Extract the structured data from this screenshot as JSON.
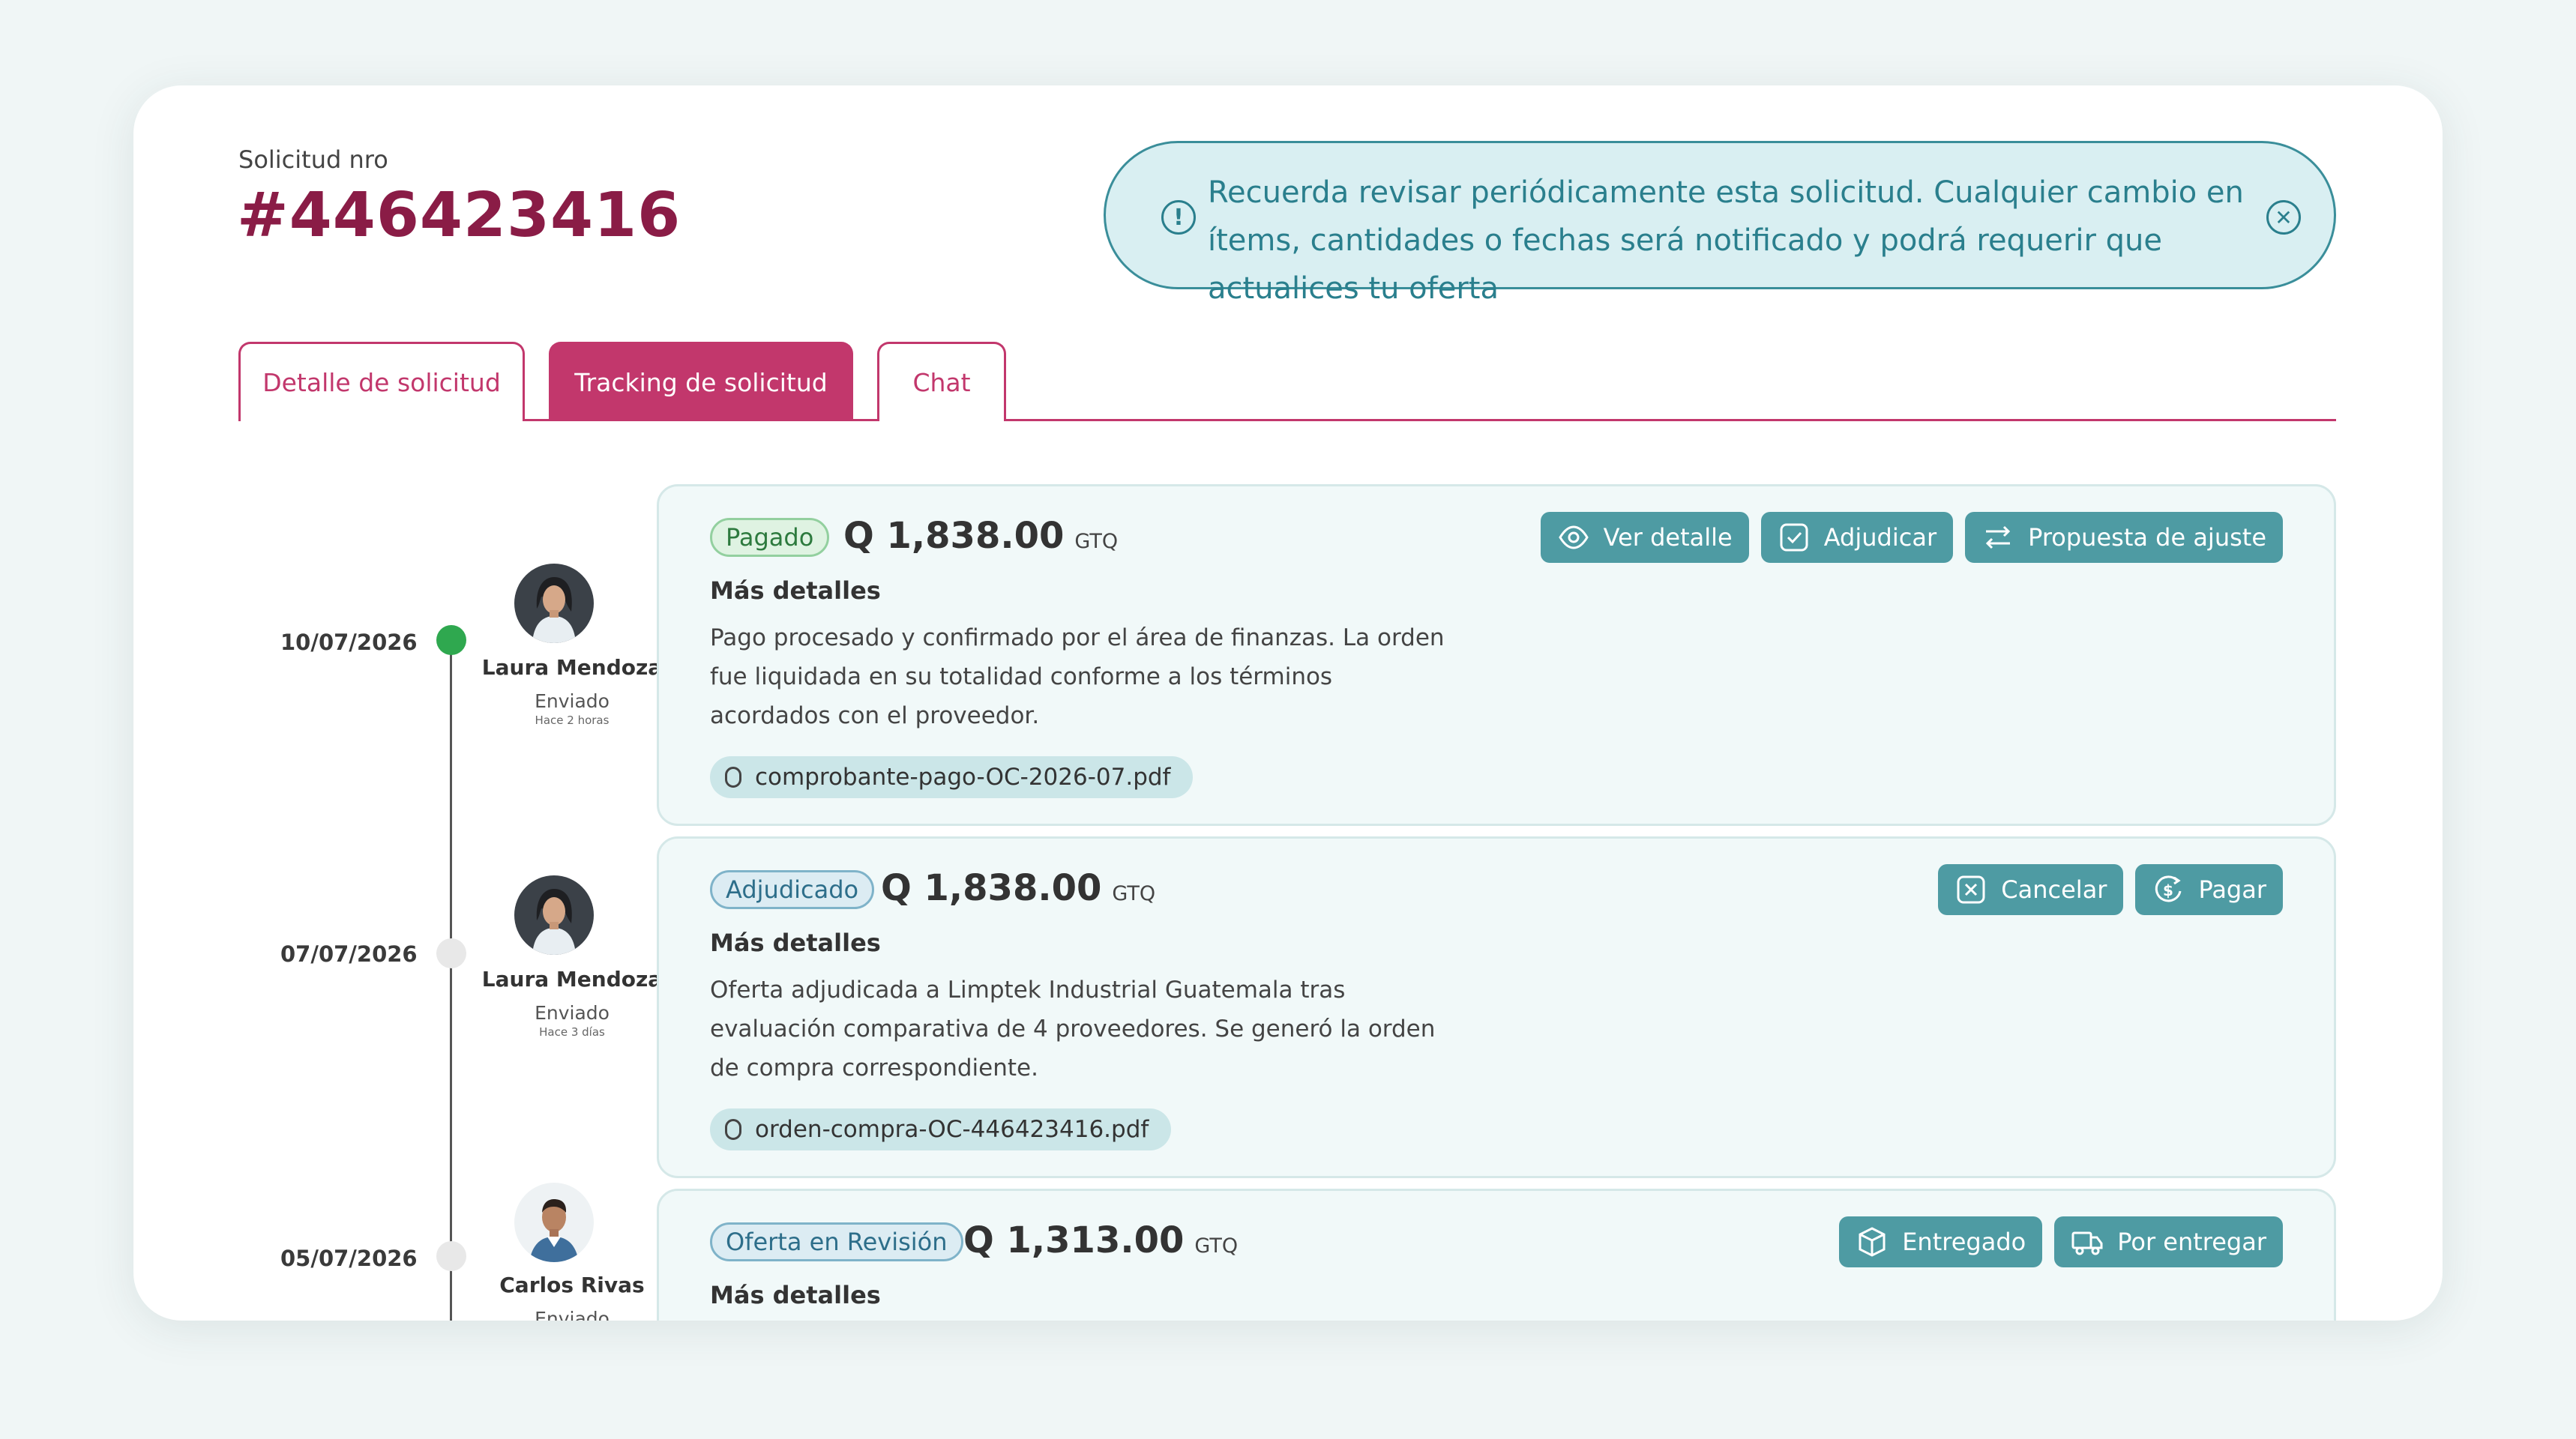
{
  "header": {
    "request_label": "Solicitud nro",
    "request_number": "#446423416"
  },
  "notice": {
    "text": "Recuerda revisar periódicamente esta solicitud. Cualquier cambio en ítems, cantidades o fechas será notificado y podrá requerir que actualices tu oferta"
  },
  "tabs": [
    {
      "label": "Detalle de solicitud"
    },
    {
      "label": "Tracking de solicitud"
    },
    {
      "label": "Chat"
    }
  ],
  "timeline": [
    {
      "date": "10/07/2026",
      "person": {
        "name": "Laura Mendoza",
        "status": "Enviado",
        "time": "Hace 2 horas"
      },
      "badge": "Pagado",
      "amount": "Q 1,838.00",
      "currency": "GTQ",
      "more": "Más detalles",
      "description": "Pago procesado y confirmado por el área de finanzas. La orden fue liquidada en su totalidad conforme a los términos acordados con el proveedor.",
      "attachment": "comprobante-pago-OC-2026-07.pdf",
      "actions": [
        "Ver detalle",
        "Adjudicar",
        "Propuesta de ajuste"
      ]
    },
    {
      "date": "07/07/2026",
      "person": {
        "name": "Laura Mendoza",
        "status": "Enviado",
        "time": "Hace 3 días"
      },
      "badge": "Adjudicado",
      "amount": "Q 1,838.00",
      "currency": "GTQ",
      "more": "Más detalles",
      "description": "Oferta adjudicada a Limptek Industrial Guatemala tras evaluación comparativa de 4 proveedores. Se generó la orden de compra correspondiente.",
      "attachment": "orden-compra-OC-446423416.pdf",
      "actions": [
        "Cancelar",
        "Pagar"
      ]
    },
    {
      "date": "05/07/2026",
      "person": {
        "name": "Carlos Rivas",
        "status": "Enviado"
      },
      "badge": "Oferta en Revisión",
      "amount": "Q 1,313.00",
      "currency": "GTQ",
      "more": "Más detalles",
      "actions": [
        "Entregado",
        "Por entregar"
      ]
    }
  ],
  "colors": {
    "brand": "#8a1c46",
    "tab_accent": "#c2376c",
    "action_button": "#4e9ba3",
    "notice_text": "#2a7f8d",
    "done_dot": "#2fa84f"
  },
  "icons": {
    "notice": "info-circle-icon",
    "close": "close-circle-icon",
    "attachment": "paperclip-icon",
    "view": "eye-icon",
    "award": "check-square-icon",
    "adjust": "swap-arrows-icon",
    "cancel": "x-square-icon",
    "pay": "dollar-refresh-icon",
    "delivered": "box-icon",
    "to_deliver": "truck-icon"
  }
}
